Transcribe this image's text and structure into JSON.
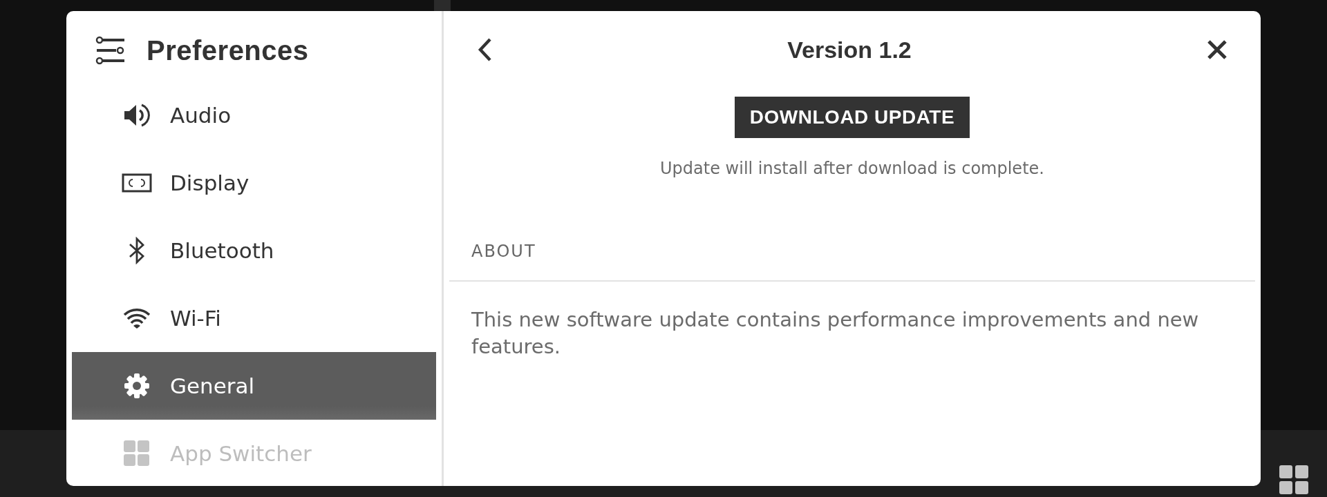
{
  "sidebar": {
    "title": "Preferences",
    "items": [
      {
        "label": "Audio",
        "kind": "audio",
        "selected": false,
        "disabled": false
      },
      {
        "label": "Display",
        "kind": "display",
        "selected": false,
        "disabled": false
      },
      {
        "label": "Bluetooth",
        "kind": "bluetooth",
        "selected": false,
        "disabled": false
      },
      {
        "label": "Wi-Fi",
        "kind": "wifi",
        "selected": false,
        "disabled": false
      },
      {
        "label": "General",
        "kind": "gear",
        "selected": true,
        "disabled": false
      },
      {
        "label": "App Switcher",
        "kind": "grid",
        "selected": false,
        "disabled": true
      }
    ]
  },
  "panel": {
    "title": "Version 1.2",
    "button": "DOWNLOAD UPDATE",
    "note": "Update will install after download is complete.",
    "section": "ABOUT",
    "description": "This new software update contains performance improvements and new features."
  }
}
